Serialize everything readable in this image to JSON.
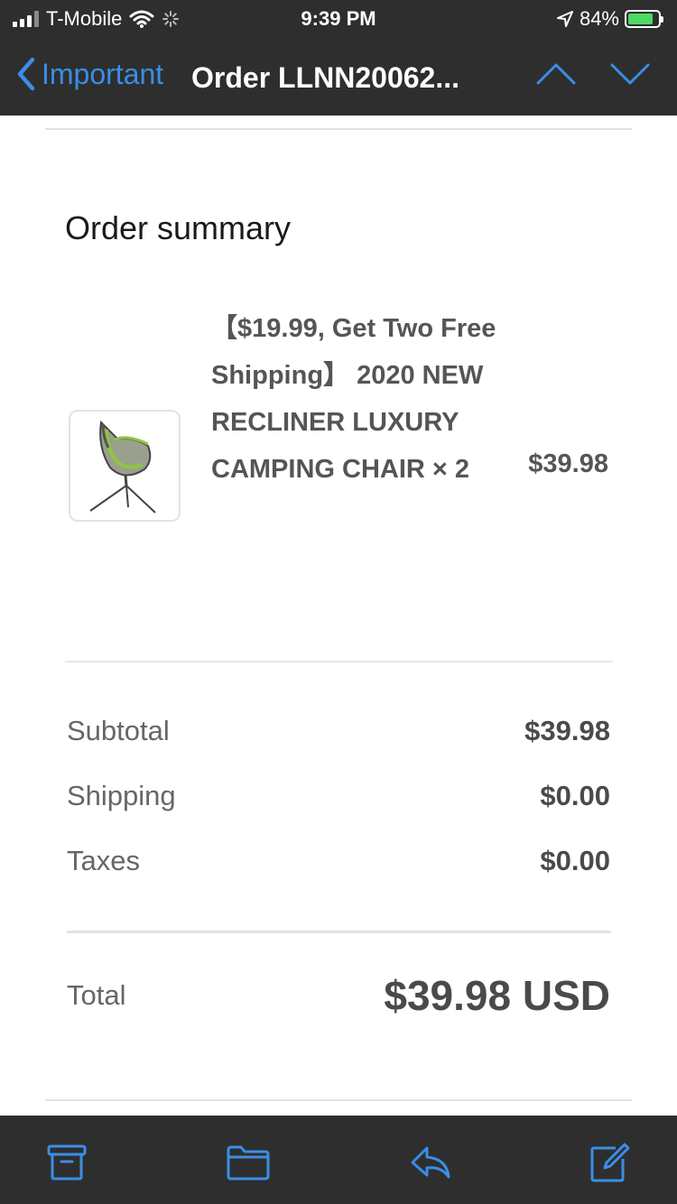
{
  "status_bar": {
    "carrier": "T-Mobile",
    "time": "9:39 PM",
    "battery": "84%",
    "battery_level": 0.84
  },
  "nav": {
    "back_label": "Important",
    "title": "Order LLNN20062..."
  },
  "order": {
    "heading": "Order summary",
    "item": {
      "title": "【$19.99, Get Two Free Shipping】 2020 NEW RECLINER LUXURY CAMPING CHAIR × 2",
      "price": "$39.98"
    },
    "rows": [
      {
        "label": "Subtotal",
        "value": "$39.98"
      },
      {
        "label": "Shipping",
        "value": "$0.00"
      },
      {
        "label": "Taxes",
        "value": "$0.00"
      }
    ],
    "total": {
      "label": "Total",
      "value": "$39.98 USD"
    }
  },
  "toolbar": {
    "icons": [
      "archive-icon",
      "folder-icon",
      "reply-icon",
      "compose-icon"
    ]
  },
  "colors": {
    "bar_bg": "#2e2e2e",
    "accent": "#3a8ee6",
    "text_dark": "#1a1a1a",
    "text_gray": "#666666"
  }
}
